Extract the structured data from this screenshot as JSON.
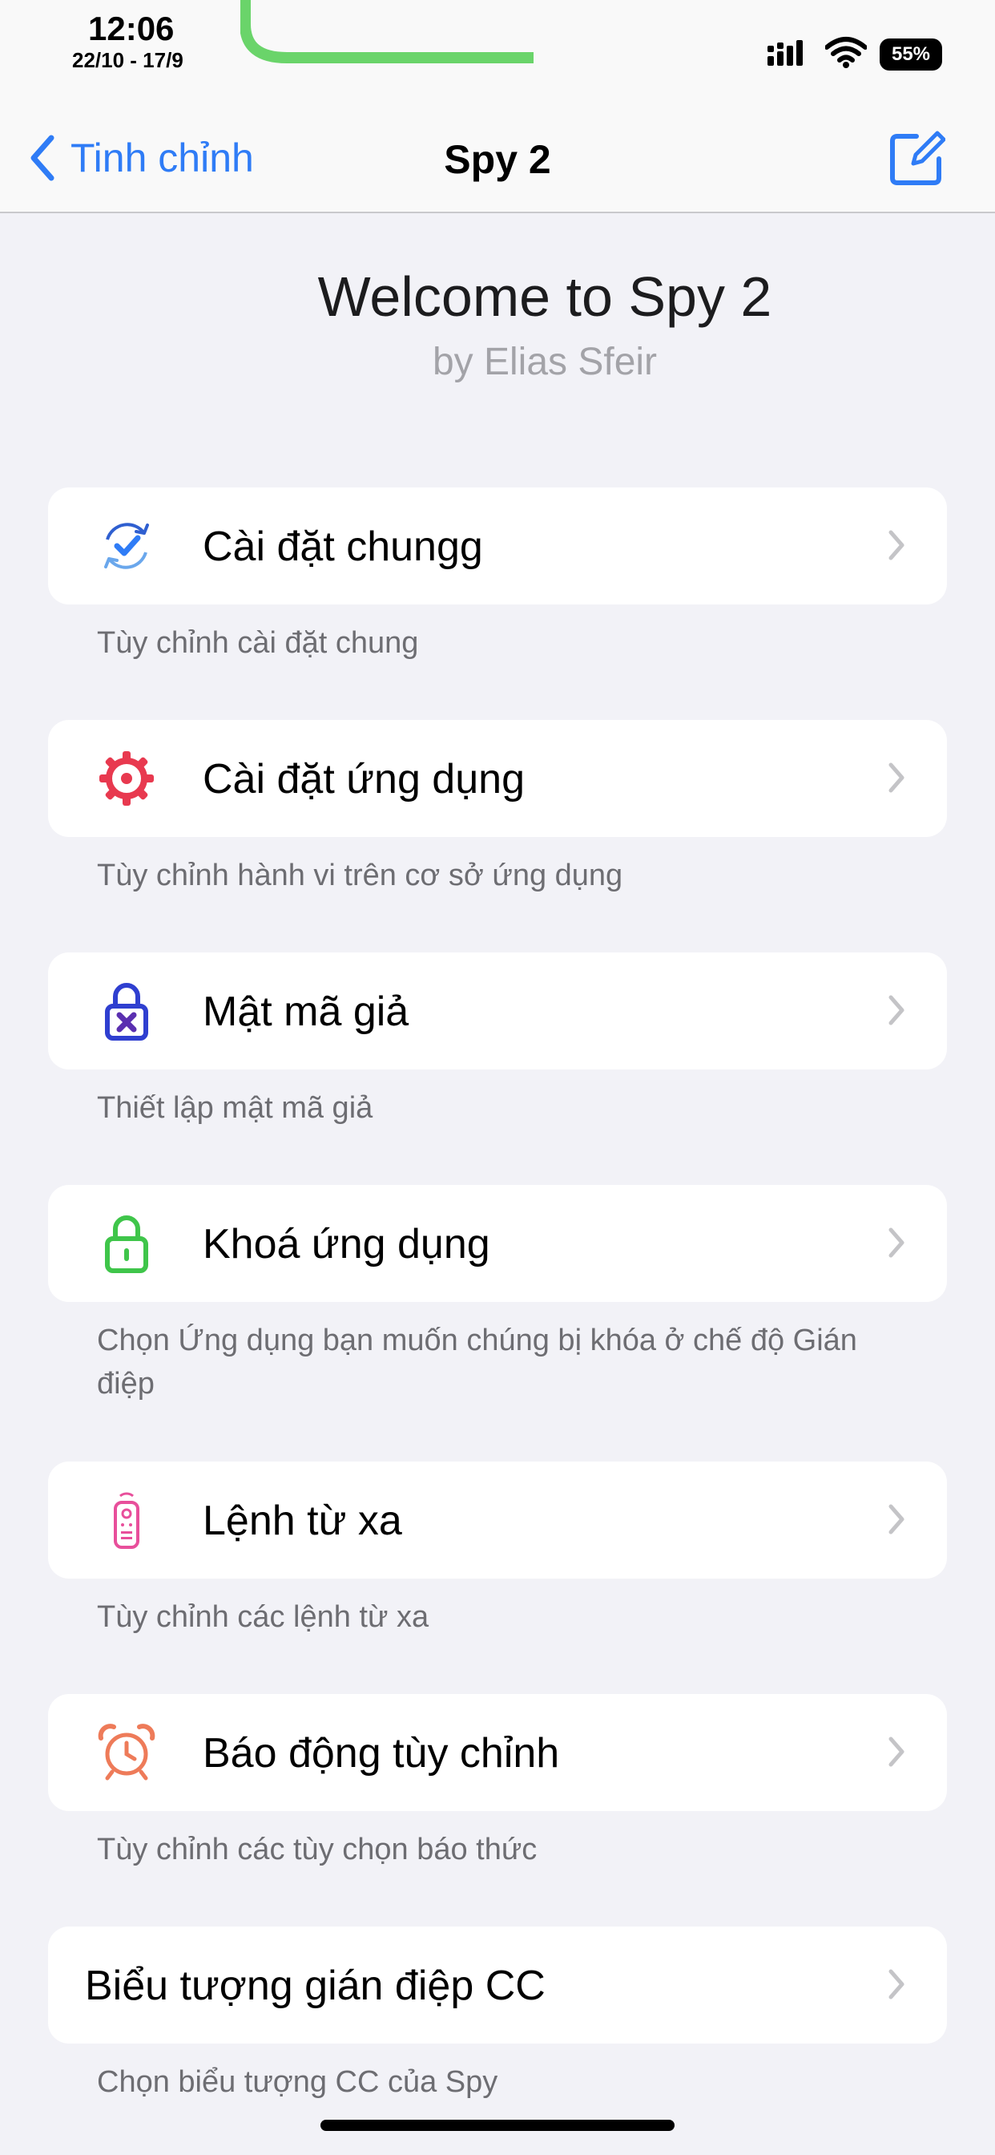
{
  "status_bar": {
    "time": "12:06",
    "date_range": "22/10 - 17/9",
    "battery": "55%"
  },
  "nav": {
    "back_label": "Tinh chỉnh",
    "title": "Spy 2"
  },
  "header": {
    "title": "Welcome to Spy 2",
    "subtitle": "by Elias Sfeir"
  },
  "cells": [
    {
      "label": "Cài đặt chungg",
      "footer": "Tùy chỉnh cài đặt chung",
      "icon": "refresh-check-icon"
    },
    {
      "label": "Cài đặt ứng dụng",
      "footer": "Tùy chỉnh hành vi trên cơ sở ứng dụng",
      "icon": "gear-icon"
    },
    {
      "label": "Mật mã giả",
      "footer": "Thiết lập mật mã giả",
      "icon": "lock-x-icon"
    },
    {
      "label": "Khoá ứng dụng",
      "footer": "Chọn Ứng dụng bạn muốn chúng bị khóa ở chế độ Gián điệp",
      "icon": "lock-open-icon"
    },
    {
      "label": "Lệnh từ xa",
      "footer": "Tùy chỉnh các lệnh từ xa",
      "icon": "remote-icon"
    },
    {
      "label": "Báo động tùy chỉnh",
      "footer": "Tùy chỉnh các tùy chọn báo thức",
      "icon": "alarm-clock-icon"
    },
    {
      "label": "Biểu tượng gián điệp CC",
      "footer": "Chọn biểu tượng CC của Spy",
      "icon": ""
    }
  ],
  "colors": {
    "accent": "#2f7cf6",
    "background": "#f2f2f7",
    "timer_green": "#6ad46a"
  }
}
